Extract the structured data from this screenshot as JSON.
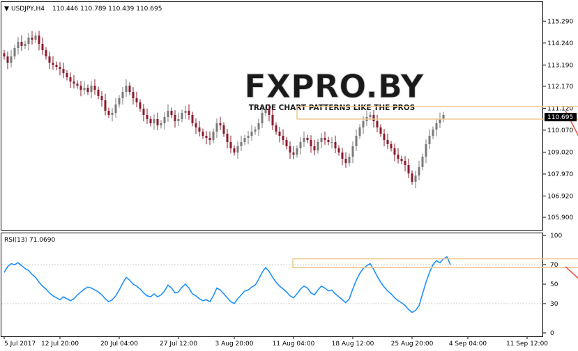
{
  "header": {
    "symbol": "USDJPY,H4",
    "ohlc": "110.446 110.789 110.439 110.695",
    "rsi": "RSI(13) 71.0690"
  },
  "watermark": {
    "brand": "FXPRO.BY",
    "tagline": "TRADE CHART PATTERNS LIKE THE PROS"
  },
  "colors": {
    "bull": "#7a7a7a",
    "bear": "#8b1a2b",
    "rsi_line": "#1e90ff",
    "zone": "#f0c890",
    "arrow": "#f24a3c",
    "grid": "#cccccc",
    "price_box": "#000000"
  },
  "chart_data": [
    {
      "type": "candlestick",
      "ylim": [
        105.3,
        116.2
      ],
      "y_ticks": [
        "115.290",
        "114.240",
        "113.190",
        "112.170",
        "111.120",
        "110.070",
        "109.020",
        "107.970",
        "106.920",
        "105.900"
      ],
      "y_tick_values": [
        115.29,
        114.24,
        113.19,
        112.17,
        111.12,
        110.07,
        109.02,
        107.97,
        106.92,
        105.9
      ],
      "current_price": 110.695,
      "current_price_label": "110.695",
      "x_labels": [
        "5 Jul 2017",
        "12 Jul 20:00",
        "20 Jul 04:00",
        "27 Jul 12:00",
        "3 Aug 20:00",
        "11 Aug 04:00",
        "18 Aug 12:00",
        "25 Aug 20:00",
        "4 Sep 04:00",
        "11 Sep 12:00"
      ],
      "x_label_index": [
        0,
        16,
        33,
        50,
        66,
        83,
        100,
        117,
        133,
        150
      ],
      "resistance_zone": [
        110.6,
        111.2
      ],
      "zone_index": [
        84,
        174
      ],
      "arrow_index": [
        161,
        170
      ],
      "arrow_price": [
        111.0,
        108.1
      ],
      "closes": [
        113.6,
        113.3,
        113.6,
        114.0,
        114.3,
        114.1,
        114.2,
        114.5,
        114.4,
        114.6,
        114.2,
        113.9,
        113.6,
        113.3,
        113.2,
        113.1,
        113.0,
        112.8,
        112.6,
        112.4,
        112.3,
        112.2,
        112.0,
        112.1,
        111.9,
        112.2,
        112.0,
        111.7,
        111.5,
        111.0,
        110.8,
        110.9,
        111.3,
        111.6,
        111.9,
        112.2,
        111.9,
        111.6,
        111.4,
        111.1,
        110.8,
        110.6,
        110.4,
        110.6,
        110.3,
        110.4,
        110.7,
        111.0,
        110.8,
        110.5,
        110.6,
        110.9,
        111.0,
        110.8,
        110.4,
        110.2,
        110.0,
        109.8,
        109.7,
        109.6,
        110.0,
        110.4,
        110.3,
        109.9,
        109.5,
        109.2,
        109.0,
        109.3,
        109.5,
        109.7,
        109.8,
        110.0,
        110.1,
        110.4,
        110.9,
        111.1,
        110.8,
        110.3,
        110.0,
        109.8,
        109.6,
        109.3,
        109.0,
        108.9,
        109.2,
        109.5,
        109.7,
        109.6,
        109.3,
        109.1,
        109.5,
        109.7,
        109.6,
        109.5,
        109.5,
        109.2,
        109.0,
        108.7,
        108.5,
        108.8,
        109.3,
        109.8,
        110.2,
        110.5,
        110.7,
        110.8,
        110.5,
        110.2,
        109.9,
        109.6,
        109.4,
        109.2,
        108.9,
        108.7,
        108.6,
        108.4,
        108.0,
        107.6,
        107.9,
        108.3,
        108.8,
        109.4,
        109.8,
        110.1,
        110.4,
        110.6,
        110.8
      ],
      "rsi": {
        "ylim": [
          0,
          100
        ],
        "y_ticks": [
          "100",
          "70",
          "50",
          "30",
          "0"
        ],
        "y_tick_values": [
          100,
          70,
          50,
          30,
          0
        ],
        "zone": [
          67,
          76
        ],
        "zone_index": [
          84,
          174
        ],
        "arrow_index": [
          161,
          171
        ],
        "arrow_value": [
          68,
          35
        ],
        "values": [
          62,
          68,
          71,
          70,
          72,
          69,
          66,
          64,
          60,
          57,
          52,
          48,
          45,
          41,
          38,
          36,
          34,
          37,
          35,
          33,
          35,
          39,
          42,
          45,
          47,
          46,
          44,
          42,
          39,
          35,
          32,
          34,
          38,
          44,
          51,
          57,
          54,
          50,
          48,
          45,
          41,
          38,
          37,
          40,
          37,
          39,
          43,
          49,
          46,
          41,
          42,
          47,
          50,
          46,
          40,
          38,
          35,
          33,
          34,
          32,
          38,
          46,
          44,
          40,
          36,
          32,
          30,
          35,
          39,
          43,
          44,
          47,
          49,
          55,
          62,
          67,
          63,
          57,
          52,
          48,
          45,
          42,
          38,
          36,
          40,
          45,
          48,
          46,
          41,
          39,
          44,
          48,
          46,
          43,
          44,
          40,
          37,
          34,
          31,
          35,
          45,
          54,
          61,
          66,
          69,
          71,
          65,
          58,
          52,
          47,
          43,
          40,
          36,
          33,
          31,
          28,
          24,
          21,
          23,
          28,
          40,
          52,
          62,
          70,
          74,
          72,
          76,
          78,
          70
        ]
      }
    }
  ]
}
